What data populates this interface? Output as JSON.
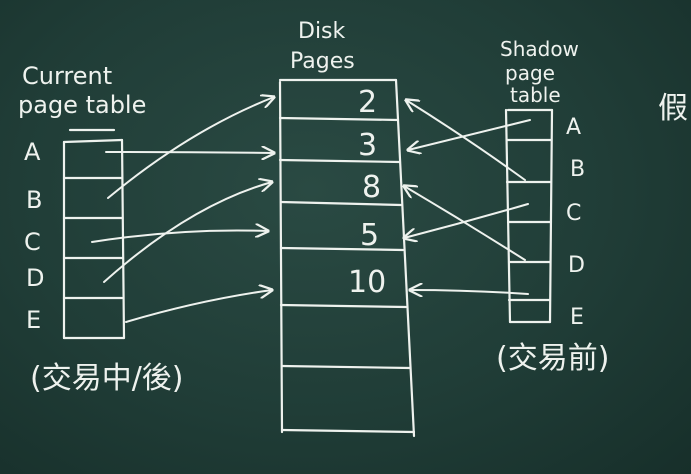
{
  "current_table": {
    "title_line1": "Current",
    "title_line2": "page table",
    "rows": [
      "A",
      "B",
      "C",
      "D",
      "E"
    ],
    "note": "(交易中/後)"
  },
  "disk": {
    "title_line1": "Disk",
    "title_line2": "Pages",
    "pages": [
      "2",
      "3",
      "8",
      "5",
      "10"
    ]
  },
  "shadow_table": {
    "title_line1": "Shadow",
    "title_line2": "page",
    "title_line3": "table",
    "rows": [
      "A",
      "B",
      "C",
      "D",
      "E"
    ],
    "note": "(交易前)"
  },
  "edge_char": "假",
  "colors": {
    "board": "#1f3b35",
    "chalk": "#eef2ee"
  }
}
